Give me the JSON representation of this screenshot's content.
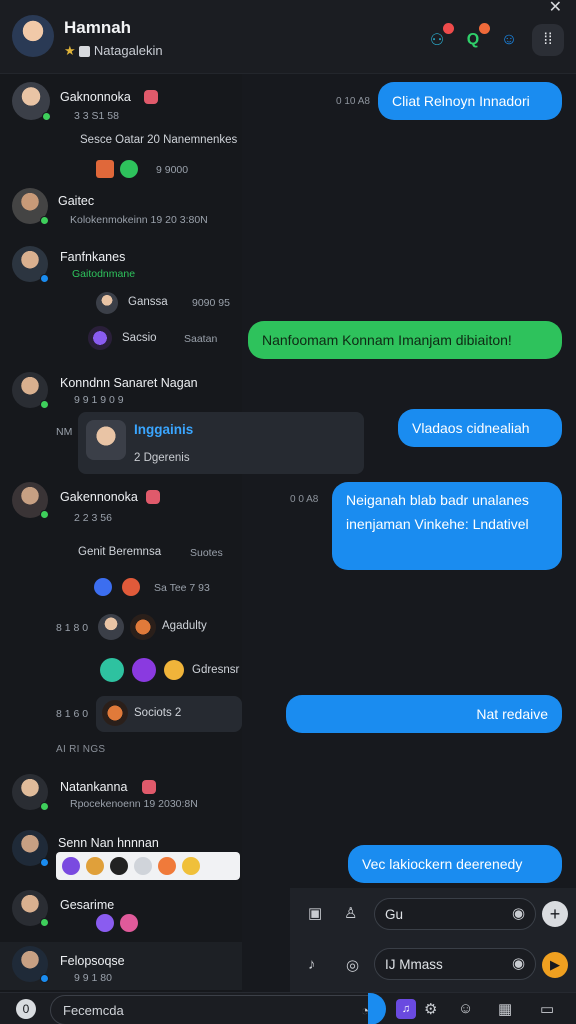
{
  "header": {
    "name": "Hamnah",
    "subtitle": "Natagalekin"
  },
  "list": {
    "rows": [
      {
        "name": "Gaknonnoka",
        "meta": "3 3 S1 58"
      },
      {
        "name": "Sesce Oatar 20 Nanemnenkes",
        "meta": "9 9000"
      },
      {
        "name": "Gaitec",
        "meta": "Kolokenmokeinn 19 20 3:80N"
      },
      {
        "name": "Fanfnkanes",
        "meta": "Gaitodnmane"
      },
      {
        "name": "Ganssa",
        "meta": "9090 95"
      },
      {
        "name": "Sacsio",
        "meta": "Saatan"
      },
      {
        "name": "Konndnn Sanaret Nagan",
        "meta": "9 9 1 9 0 9"
      },
      {
        "name": "Gakennonoka",
        "meta": "2 2 3 56"
      },
      {
        "name": "Genit Beremnsa",
        "meta": "Suotes"
      },
      {
        "name": "Sa Tee 7 93",
        "meta": ""
      },
      {
        "name": "Agadulty",
        "meta": "8 1 8 0"
      },
      {
        "name": "Gdresnsr",
        "meta": ""
      },
      {
        "name": "Sociots 2",
        "meta": "8 1 6 0"
      },
      {
        "name": "Natankanna",
        "meta": "Rpocekenoenn 19 2030:8N"
      },
      {
        "name": "Senn Nan hnnnan",
        "meta": ""
      },
      {
        "name": "Gesarime",
        "meta": ""
      },
      {
        "name": "Felopsoqse",
        "meta": "9 9 1 80"
      }
    ],
    "section_label": "AI RI NGS"
  },
  "card": {
    "title": "Inggainis",
    "sub": "2 Dgerenis"
  },
  "messages": [
    {
      "text": "Cliat Relnoyn Innadori",
      "time": "0 10 A8"
    },
    {
      "text": "Nanfoomam Konnam Imanjam dibiaiton!",
      "time": ""
    },
    {
      "text": "Vladaos cidnealiah",
      "time": ""
    },
    {
      "text": "Neiganah blab badr unalanes inenjaman Vinkehe: Lndativel",
      "time": "0 0 A8"
    },
    {
      "text": "Nat redaive",
      "time": ""
    },
    {
      "text": "Vec lakiockern deerenedy",
      "time": ""
    }
  ],
  "composers": [
    {
      "value": "Gu"
    },
    {
      "value": "IJ Mmass"
    }
  ],
  "search": {
    "placeholder": "Fecemcda"
  },
  "colors": {
    "accent": "#1a8cf0",
    "green": "#2ec25c",
    "background": "#17191e"
  }
}
